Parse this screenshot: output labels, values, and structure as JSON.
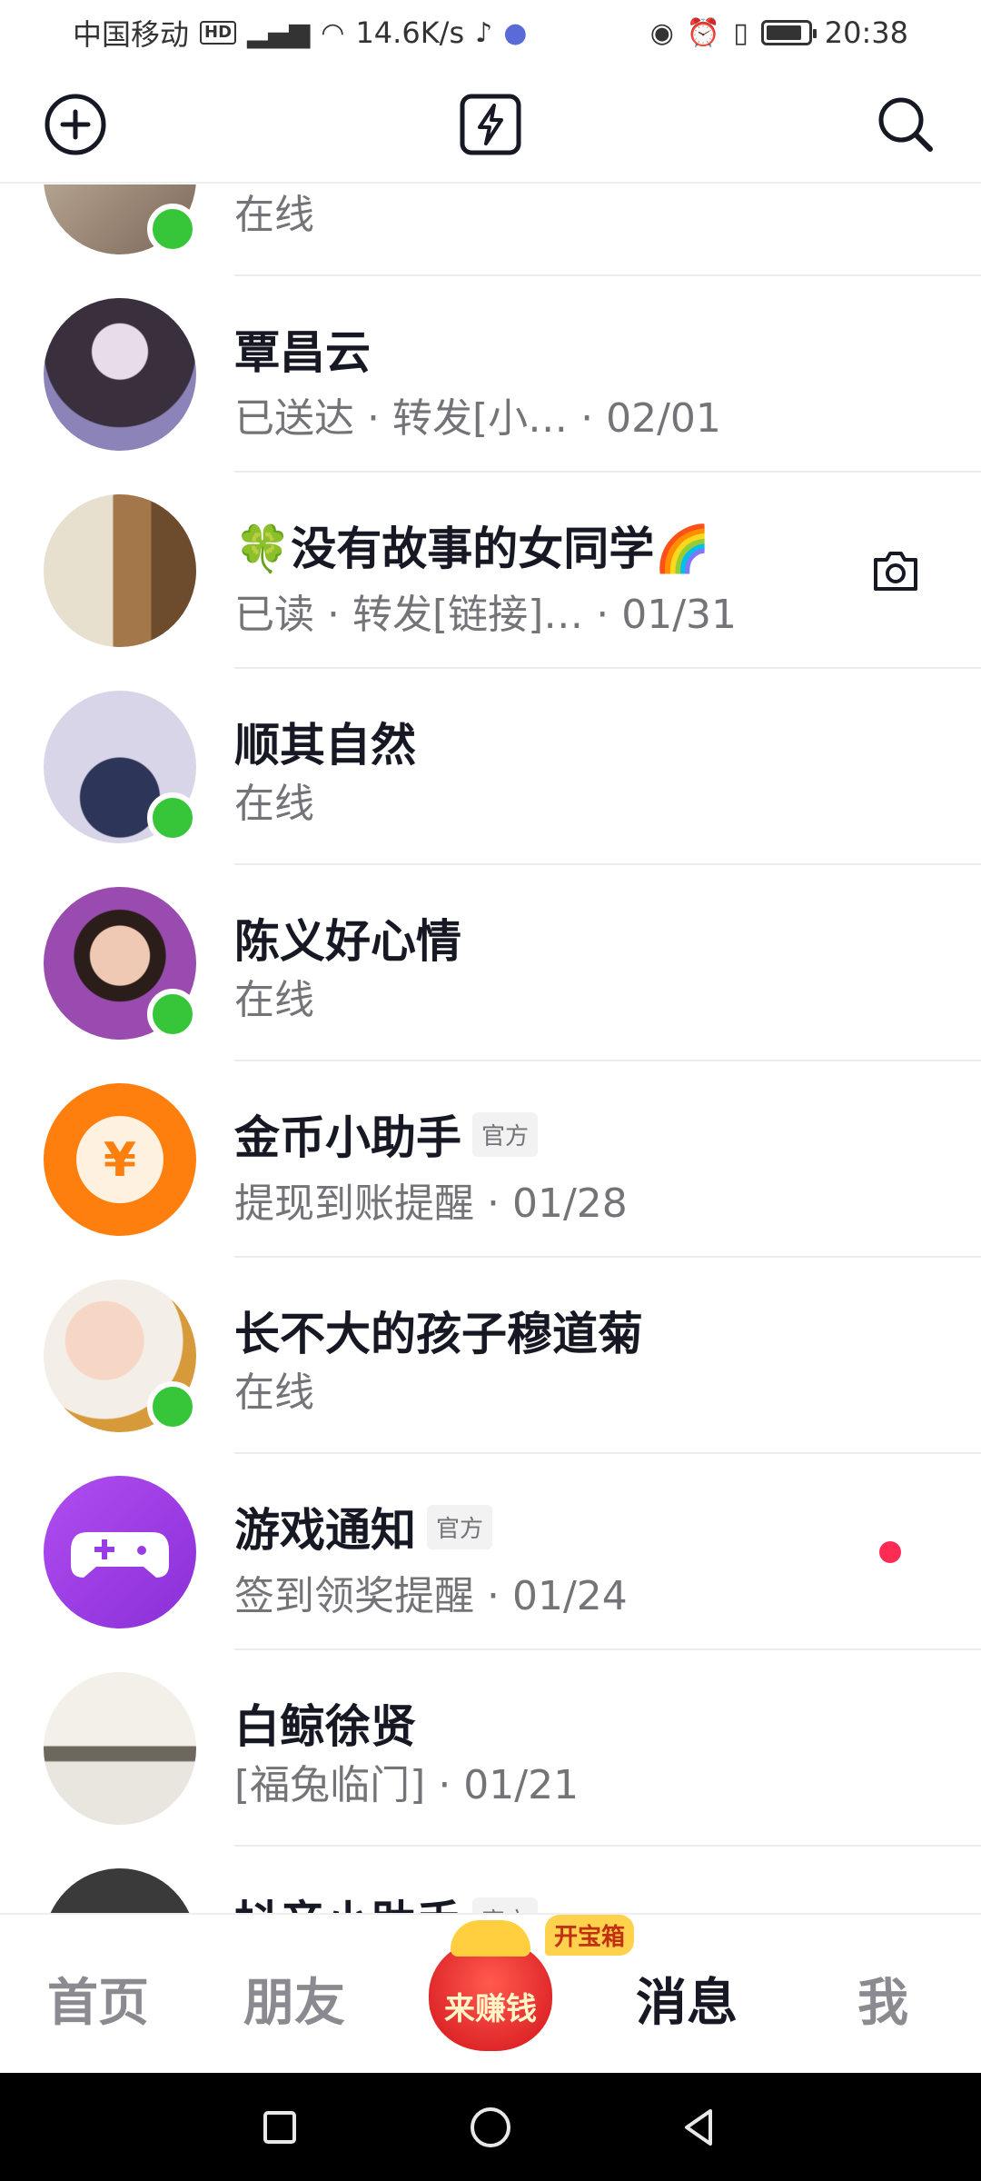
{
  "status_bar": {
    "carrier": "中国移动",
    "hd": "HD",
    "network": "⁵ᴳ.ıl",
    "speed": "14.6K/s",
    "time": "20:38",
    "battery_level": 0.8
  },
  "header": {
    "add_icon": "plus-circle-icon",
    "center_icon": "lightning-icon",
    "search_icon": "search-icon"
  },
  "conversations": [
    {
      "name": "",
      "subtitle": "在线",
      "online": true,
      "avatar": "photo"
    },
    {
      "name": "覃昌云",
      "subtitle": "已送达 · 转发[小…    · 02/01",
      "online": false,
      "avatar": "photo"
    },
    {
      "name": "🍀没有故事的女同学🌈",
      "subtitle": "已读 · 转发[链接]…    · 01/31",
      "online": false,
      "avatar": "photo",
      "action_icon": "camera-icon"
    },
    {
      "name": "顺其自然",
      "subtitle": "在线",
      "online": true,
      "avatar": "photo"
    },
    {
      "name": "陈义好心情",
      "subtitle": "在线",
      "online": true,
      "avatar": "photo"
    },
    {
      "name": "金币小助手",
      "tag": "官方",
      "subtitle": "提现到账提醒  · 01/28",
      "online": false,
      "avatar": "yuan-coin-icon"
    },
    {
      "name": "长不大的孩子穆道菊",
      "subtitle": "在线",
      "online": true,
      "avatar": "photo"
    },
    {
      "name": "游戏通知",
      "tag": "官方",
      "subtitle": "签到领奖提醒 · 01/24",
      "online": false,
      "avatar": "gamepad-icon",
      "unread": true
    },
    {
      "name": "白鲸徐贤",
      "subtitle": "[福兔临门] · 01/21",
      "online": false,
      "avatar": "photo"
    },
    {
      "name": "抖音小助手",
      "tag": "官方",
      "subtitle": "",
      "online": false,
      "avatar": "photo"
    }
  ],
  "tabbar": {
    "home": "首页",
    "friends": "朋友",
    "earn": "来赚钱",
    "chest": "开宝箱",
    "messages": "消息",
    "me": "我",
    "active": "messages"
  },
  "colors": {
    "online": "#37c53a",
    "unread": "#fe2c55",
    "coin_orange": "#ff7f0e",
    "game_purple": "#9a3ce6"
  }
}
